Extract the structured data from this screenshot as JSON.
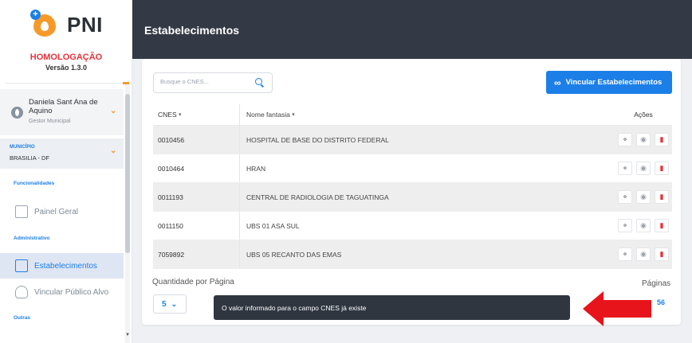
{
  "app": {
    "logo_text": "PNI",
    "environment": "HOMOLOGAÇÃO",
    "version": "Versão 1.3.0"
  },
  "user": {
    "name": "Daniela Sant Ana de Aquino",
    "role": "Gestor Municipal"
  },
  "municipio": {
    "label": "MUNICÍPIO",
    "value": "BRASILIA - DF"
  },
  "sidebar": {
    "sections": {
      "funcionalidades": "Funcionalidades",
      "administrativo": "Administrativo",
      "outras": "Outras"
    },
    "items": [
      {
        "label": "Painel Geral"
      },
      {
        "label": "Estabelecimentos"
      },
      {
        "label": "Vincular Público Alvo"
      }
    ]
  },
  "header": {
    "title": "Estabelecimentos"
  },
  "search": {
    "placeholder": "Busque o CNES..."
  },
  "actions": {
    "vincular_label": "Vincular Estabelecimentos"
  },
  "table": {
    "columns": [
      "CNES",
      "Nome fantasia",
      "Ações"
    ],
    "rows": [
      {
        "cnes": "0010456",
        "nome": "HOSPITAL DE BASE DO DISTRITO FEDERAL"
      },
      {
        "cnes": "0010464",
        "nome": "HRAN"
      },
      {
        "cnes": "0011193",
        "nome": "CENTRAL DE RADIOLOGIA DE TAGUATINGA"
      },
      {
        "cnes": "0011150",
        "nome": "UBS 01 ASA SUL"
      },
      {
        "cnes": "7059892",
        "nome": "UBS 05 RECANTO DAS EMAS"
      }
    ]
  },
  "pagination": {
    "per_page_label": "Quantidade por Página",
    "per_page_value": "5",
    "pages_label": "Páginas",
    "pages_value": "56"
  },
  "toast": {
    "message": "O valor informado para o campo CNES já existe"
  },
  "colors": {
    "accent": "#1c7fe8",
    "brand_orange": "#f59a2a",
    "danger": "#e6333b",
    "header_bg": "#343a45",
    "annotation_arrow": "#e8141b"
  }
}
